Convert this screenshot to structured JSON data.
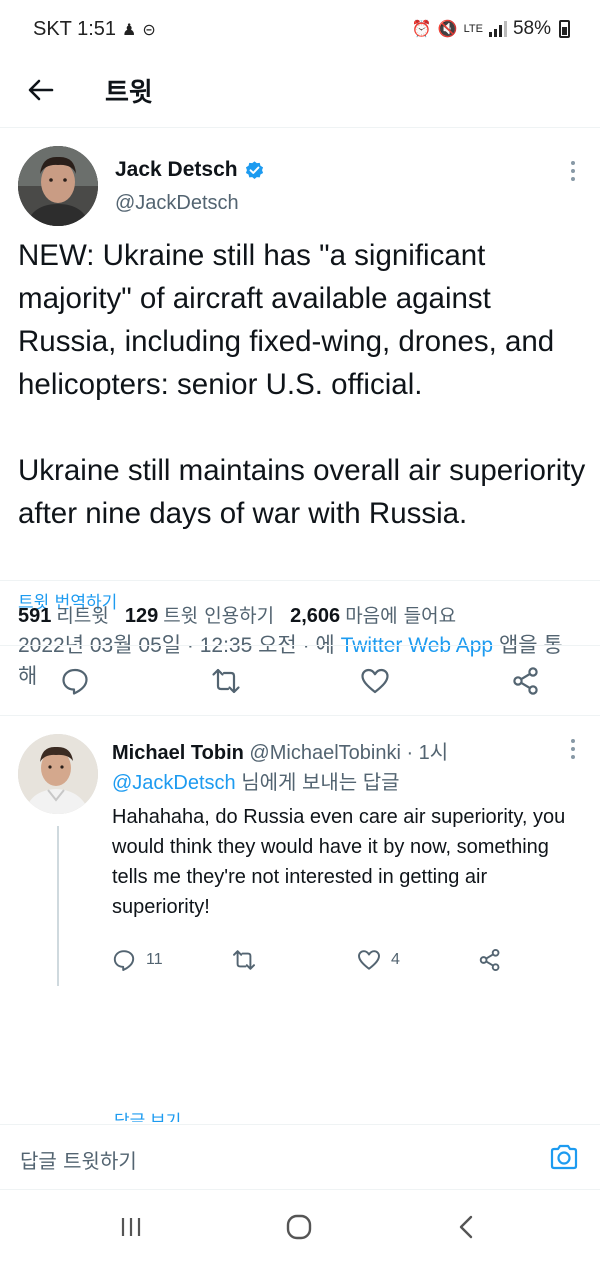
{
  "status_bar": {
    "carrier_time": "SKT 1:51",
    "battery": "58%",
    "network": "LTE",
    "icons": [
      "alarm-icon",
      "mute-icon",
      "signal-icon",
      "battery-icon"
    ]
  },
  "header": {
    "title": "트윗"
  },
  "tweet": {
    "author_name": "Jack Detsch",
    "author_handle": "@JackDetsch",
    "paragraphs": [
      "NEW: Ukraine still has \"a significant majority\" of aircraft available against Russia, including fixed-wing, drones, and helicopters: senior U.S. official.",
      "Ukraine still maintains overall air superiority after nine days of war with Russia."
    ],
    "translate_label": "트윗 번역하기",
    "timestamp": "2022년 03월 05일 · 12:35 오전 · 에 ",
    "source": "Twitter Web App",
    "source_suffix": " 앱을 통해"
  },
  "stats": {
    "retweets_count": "591",
    "retweets_label": "리트윗",
    "quotes_count": "129",
    "quotes_label": "트윗 인용하기",
    "likes_count": "2,606",
    "likes_label": "마음에 들어요"
  },
  "reply": {
    "author_name": "Michael Tobin",
    "author_handle": "@MichaelTobinki",
    "time": " · 1시",
    "replying_to_handle": "@JackDetsch",
    "replying_to_suffix": " 님에게 보내는 답글",
    "text": "Hahahaha, do Russia even care air superiority, you would think they would have it by now, something tells me they're not interested in getting air superiority!",
    "reply_count": "11",
    "like_count": "4",
    "show_replies_label": "답글 보기"
  },
  "compose": {
    "placeholder": "답글 트윗하기"
  },
  "colors": {
    "accent": "#1d9bf0",
    "secondary_text": "#536471",
    "primary_text": "#0f1419",
    "divider": "#eff3f4"
  }
}
